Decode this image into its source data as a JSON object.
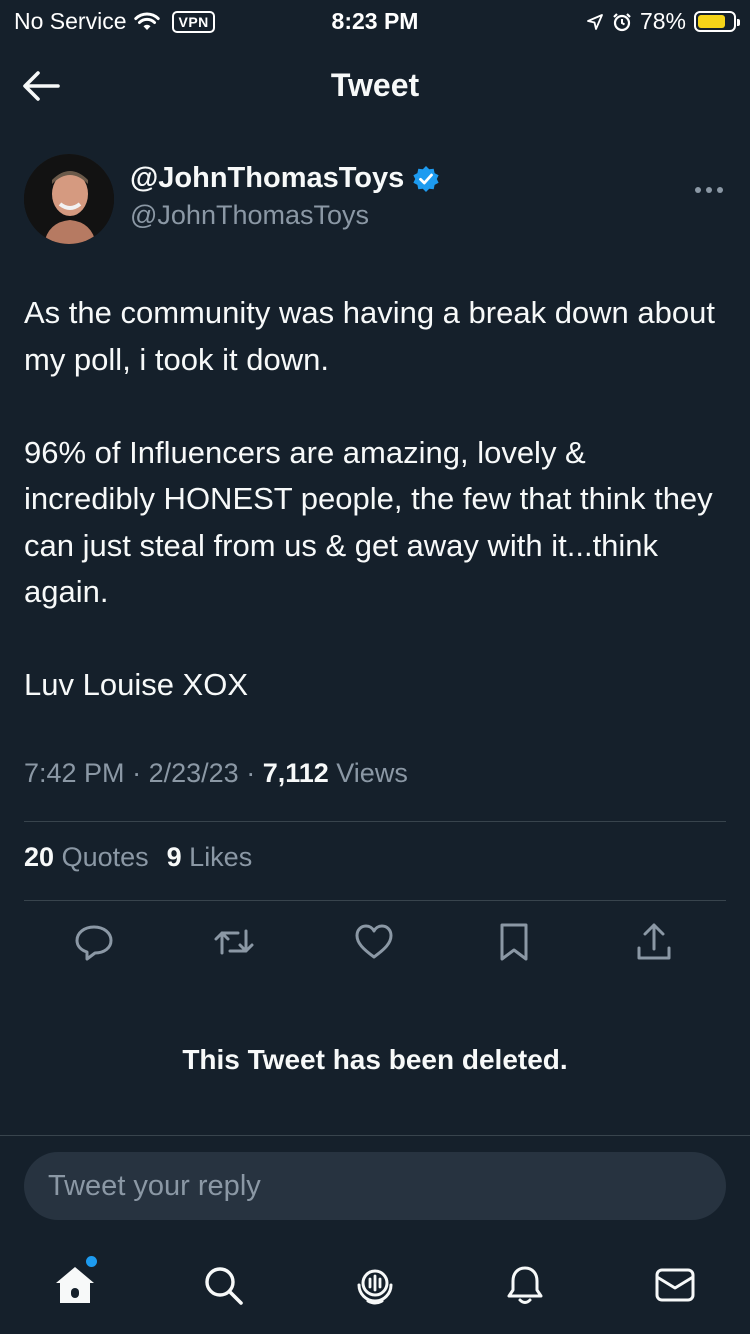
{
  "status_bar": {
    "carrier": "No Service",
    "vpn": "VPN",
    "time": "8:23 PM",
    "battery": "78%",
    "battery_level": 0.78,
    "battery_color": "#f5d418"
  },
  "nav": {
    "title": "Tweet",
    "back_icon": "arrow-left-icon"
  },
  "tweet": {
    "display_name": "@JohnThomasToys",
    "handle": "@JohnThomasToys",
    "verified_color": "#1d9bf0",
    "paragraphs": [
      "As the community was having a break down about my poll, i took it down.",
      "96% of Influencers are amazing, lovely & incredibly HONEST people, the few that think they can just steal from us & get away with it...think again.",
      "Luv Louise XOX"
    ],
    "time": "7:42 PM",
    "date": "2/23/23",
    "views_count": "7,112",
    "views_label": "Views",
    "quotes_count": "20",
    "quotes_label": "Quotes",
    "likes_count": "9",
    "likes_label": "Likes"
  },
  "actions": [
    "reply-icon",
    "retweet-icon",
    "like-icon",
    "bookmark-icon",
    "share-icon"
  ],
  "quoted_deleted": "This Tweet has been deleted.",
  "reply": {
    "placeholder": "Tweet your reply"
  },
  "tabs": [
    "home-icon",
    "search-icon",
    "spaces-icon",
    "notifications-icon",
    "messages-icon"
  ],
  "colors": {
    "background": "#15202b",
    "accent": "#1d9bf0",
    "muted": "#8b98a5"
  }
}
